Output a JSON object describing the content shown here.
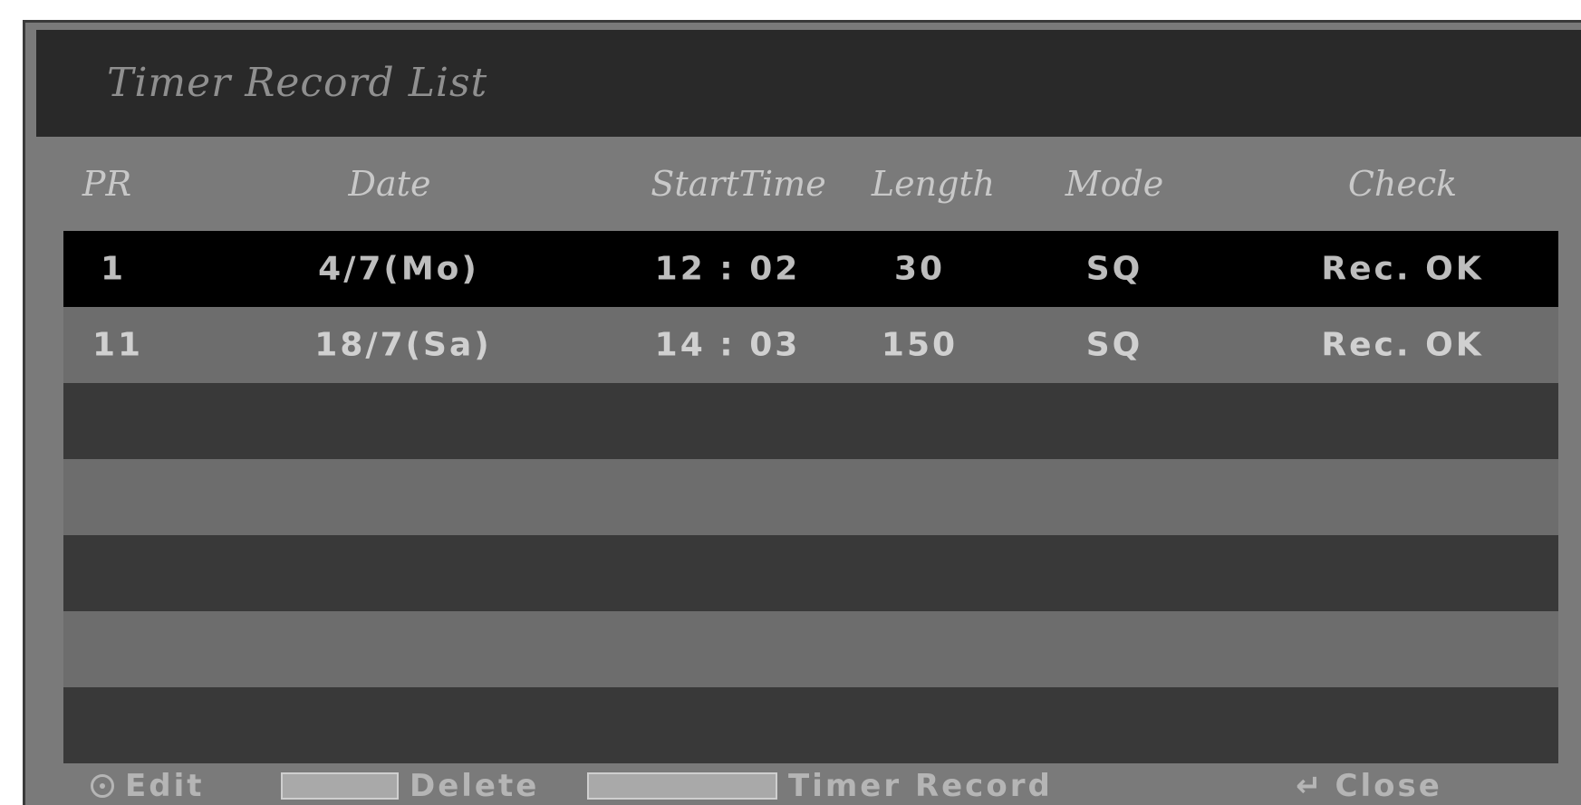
{
  "title": "Timer Record List",
  "columns": {
    "pr": "PR",
    "date": "Date",
    "start_time": "StartTime",
    "length": "Length",
    "mode": "Mode",
    "check": "Check"
  },
  "records": [
    {
      "pr": "1",
      "date": "4/7(Mo)",
      "start_time": "12 : 02",
      "length": "30",
      "mode": "SQ",
      "check": "Rec. OK",
      "selected": true
    },
    {
      "pr": "11",
      "date": "18/7(Sa)",
      "start_time": "14 : 03",
      "length": "150",
      "mode": "SQ",
      "check": "Rec. OK",
      "selected": false
    }
  ],
  "empty_rows": 5,
  "footer": {
    "edit_label": "Edit",
    "delete_label": "Delete",
    "timer_record_label": "Timer Record",
    "close_label": "Close",
    "enter_icon": "enter-icon",
    "return_icon": "return-icon",
    "return_glyph": "↵"
  },
  "colors": {
    "panel": "#7a7a7a",
    "title_bar": "#292929",
    "selected_row": "#000000",
    "row_dark": "#393939",
    "row_light": "#6d6d6d"
  }
}
